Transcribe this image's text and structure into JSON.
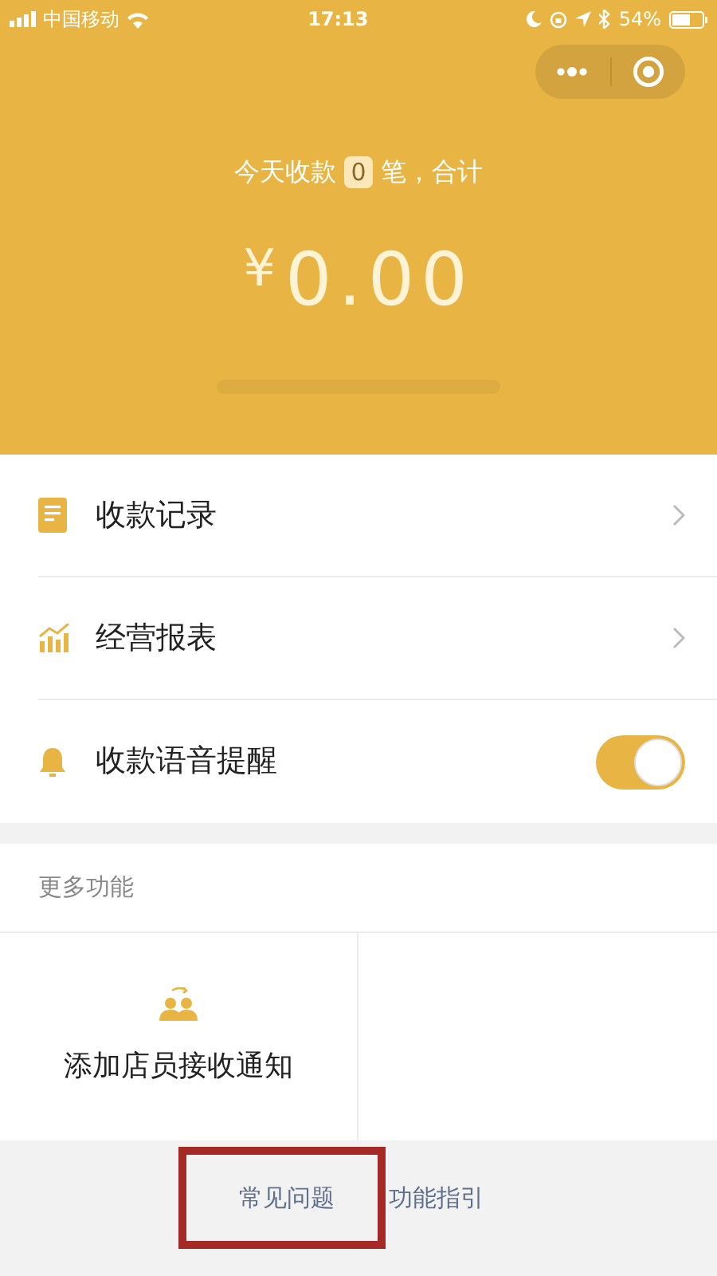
{
  "status_bar": {
    "carrier": "中国移动",
    "time": "17:13",
    "battery": "54%"
  },
  "header": {
    "summary_prefix": "今天收款",
    "count": "0",
    "summary_suffix": "笔，合计",
    "currency": "¥",
    "amount": "0.00"
  },
  "menu": [
    {
      "kind": "link",
      "label": "收款记录"
    },
    {
      "kind": "link",
      "label": "经营报表"
    },
    {
      "kind": "toggle",
      "label": "收款语音提醒",
      "on": true
    }
  ],
  "more": {
    "title": "更多功能",
    "items": [
      {
        "label": "添加店员接收通知"
      }
    ]
  },
  "footer": {
    "links": [
      {
        "label": "常见问题",
        "highlighted": true
      },
      {
        "label": "功能指引",
        "highlighted": false
      }
    ]
  }
}
